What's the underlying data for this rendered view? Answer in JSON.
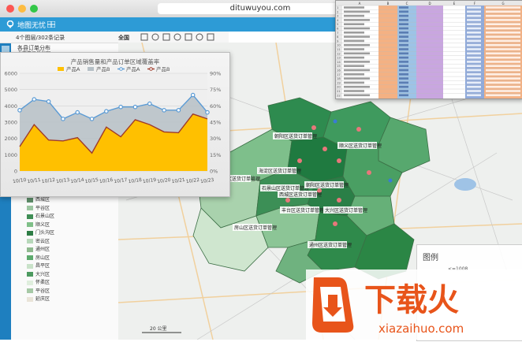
{
  "browser": {
    "url": "dituwuyou.com"
  },
  "app": {
    "title": "地图无忧",
    "record_info": "4个图层/302条记录",
    "region": "全国",
    "layer1": "各县订单分布",
    "layer2": "北京市县界地图"
  },
  "chart_data": {
    "type": "line",
    "title": "产品销售量和产品订单区域覆盖率",
    "categories": [
      "10/10",
      "10/11",
      "10/12",
      "10/13",
      "10/14",
      "10/15",
      "10/16",
      "10/17",
      "10/18",
      "10/19",
      "10/20",
      "10/21",
      "10/22",
      "10/23"
    ],
    "series": [
      {
        "name": "产品A",
        "kind": "area",
        "axis": "left",
        "color": "#ffc000",
        "values": [
          1500,
          2850,
          1900,
          1850,
          2050,
          1100,
          2700,
          2100,
          3150,
          2850,
          2400,
          2350,
          3500,
          3200
        ]
      },
      {
        "name": "产品B",
        "kind": "area",
        "axis": "right",
        "color": "#b6c0c6",
        "values": [
          56,
          66,
          64,
          48,
          54,
          48,
          55,
          59,
          59,
          62,
          56,
          56,
          70,
          54
        ]
      },
      {
        "name": "产品A",
        "kind": "line",
        "axis": "right",
        "color": "#5b9bd5",
        "values": [
          56,
          66,
          64,
          48,
          54,
          48,
          55,
          59,
          59,
          62,
          56,
          56,
          70,
          54
        ]
      },
      {
        "name": "产品B",
        "kind": "line",
        "axis": "left",
        "color": "#9e3b2b",
        "values": [
          1500,
          2850,
          1900,
          1850,
          2050,
          1100,
          2700,
          2100,
          3150,
          2850,
          2400,
          2350,
          3500,
          3200
        ]
      }
    ],
    "y_left_ticks": [
      "0",
      "1000",
      "2000",
      "3000",
      "4000",
      "5000",
      "6000"
    ],
    "y_right_ticks": [
      "0%",
      "15%",
      "30%",
      "45%",
      "60%",
      "75%",
      "90%"
    ],
    "ylim_left": [
      0,
      6000
    ],
    "ylim_right": [
      0,
      90
    ],
    "legend_position": "top-center",
    "grid": true
  },
  "legend": {
    "title": "图例",
    "range": "<=1008",
    "districts": [
      "西城区",
      "平谷区",
      "石景山区",
      "顺义区",
      "门头沟区",
      "密云区",
      "通州区",
      "房山区",
      "昌平区",
      "大兴区",
      "怀柔区",
      "平谷区",
      "延庆区"
    ],
    "colors": [
      "#5f8f6a",
      "#9cc6a1",
      "#3f8e55",
      "#7fbf88",
      "#2e7d45",
      "#b7d8ba",
      "#8fb98f",
      "#5daa6d",
      "#c9e2c9",
      "#4d9a60",
      "#dfeedd",
      "#a6c9a6",
      "#e9e4d8"
    ]
  },
  "map": {
    "labels": [
      "朝阳区送货订单管理",
      "顺义区送货订单管理",
      "海淀区送货订单管理",
      "石景山区送货订单管理",
      "门头沟区送货订单管理",
      "朝阳区送货订单管理",
      "西城区送货订单管理",
      "丰台区送货订单管理",
      "大兴区送货订单管理",
      "房山区送货订单管理",
      "通州区送货订单管理"
    ],
    "scale": "20 公里"
  },
  "sheet_header": [
    "A",
    "B",
    "C",
    "D",
    "E",
    "F",
    "G"
  ],
  "sheet_row_numbers": [
    "1",
    "2",
    "3",
    "4",
    "5",
    "6",
    "7",
    "8",
    "9",
    "10",
    "11",
    "12",
    "13",
    "14",
    "15",
    "16",
    "17",
    "18",
    "19",
    "20",
    "21",
    "22"
  ],
  "logo": {
    "text": "下载火",
    "sub": "xiazaihuo.com"
  }
}
